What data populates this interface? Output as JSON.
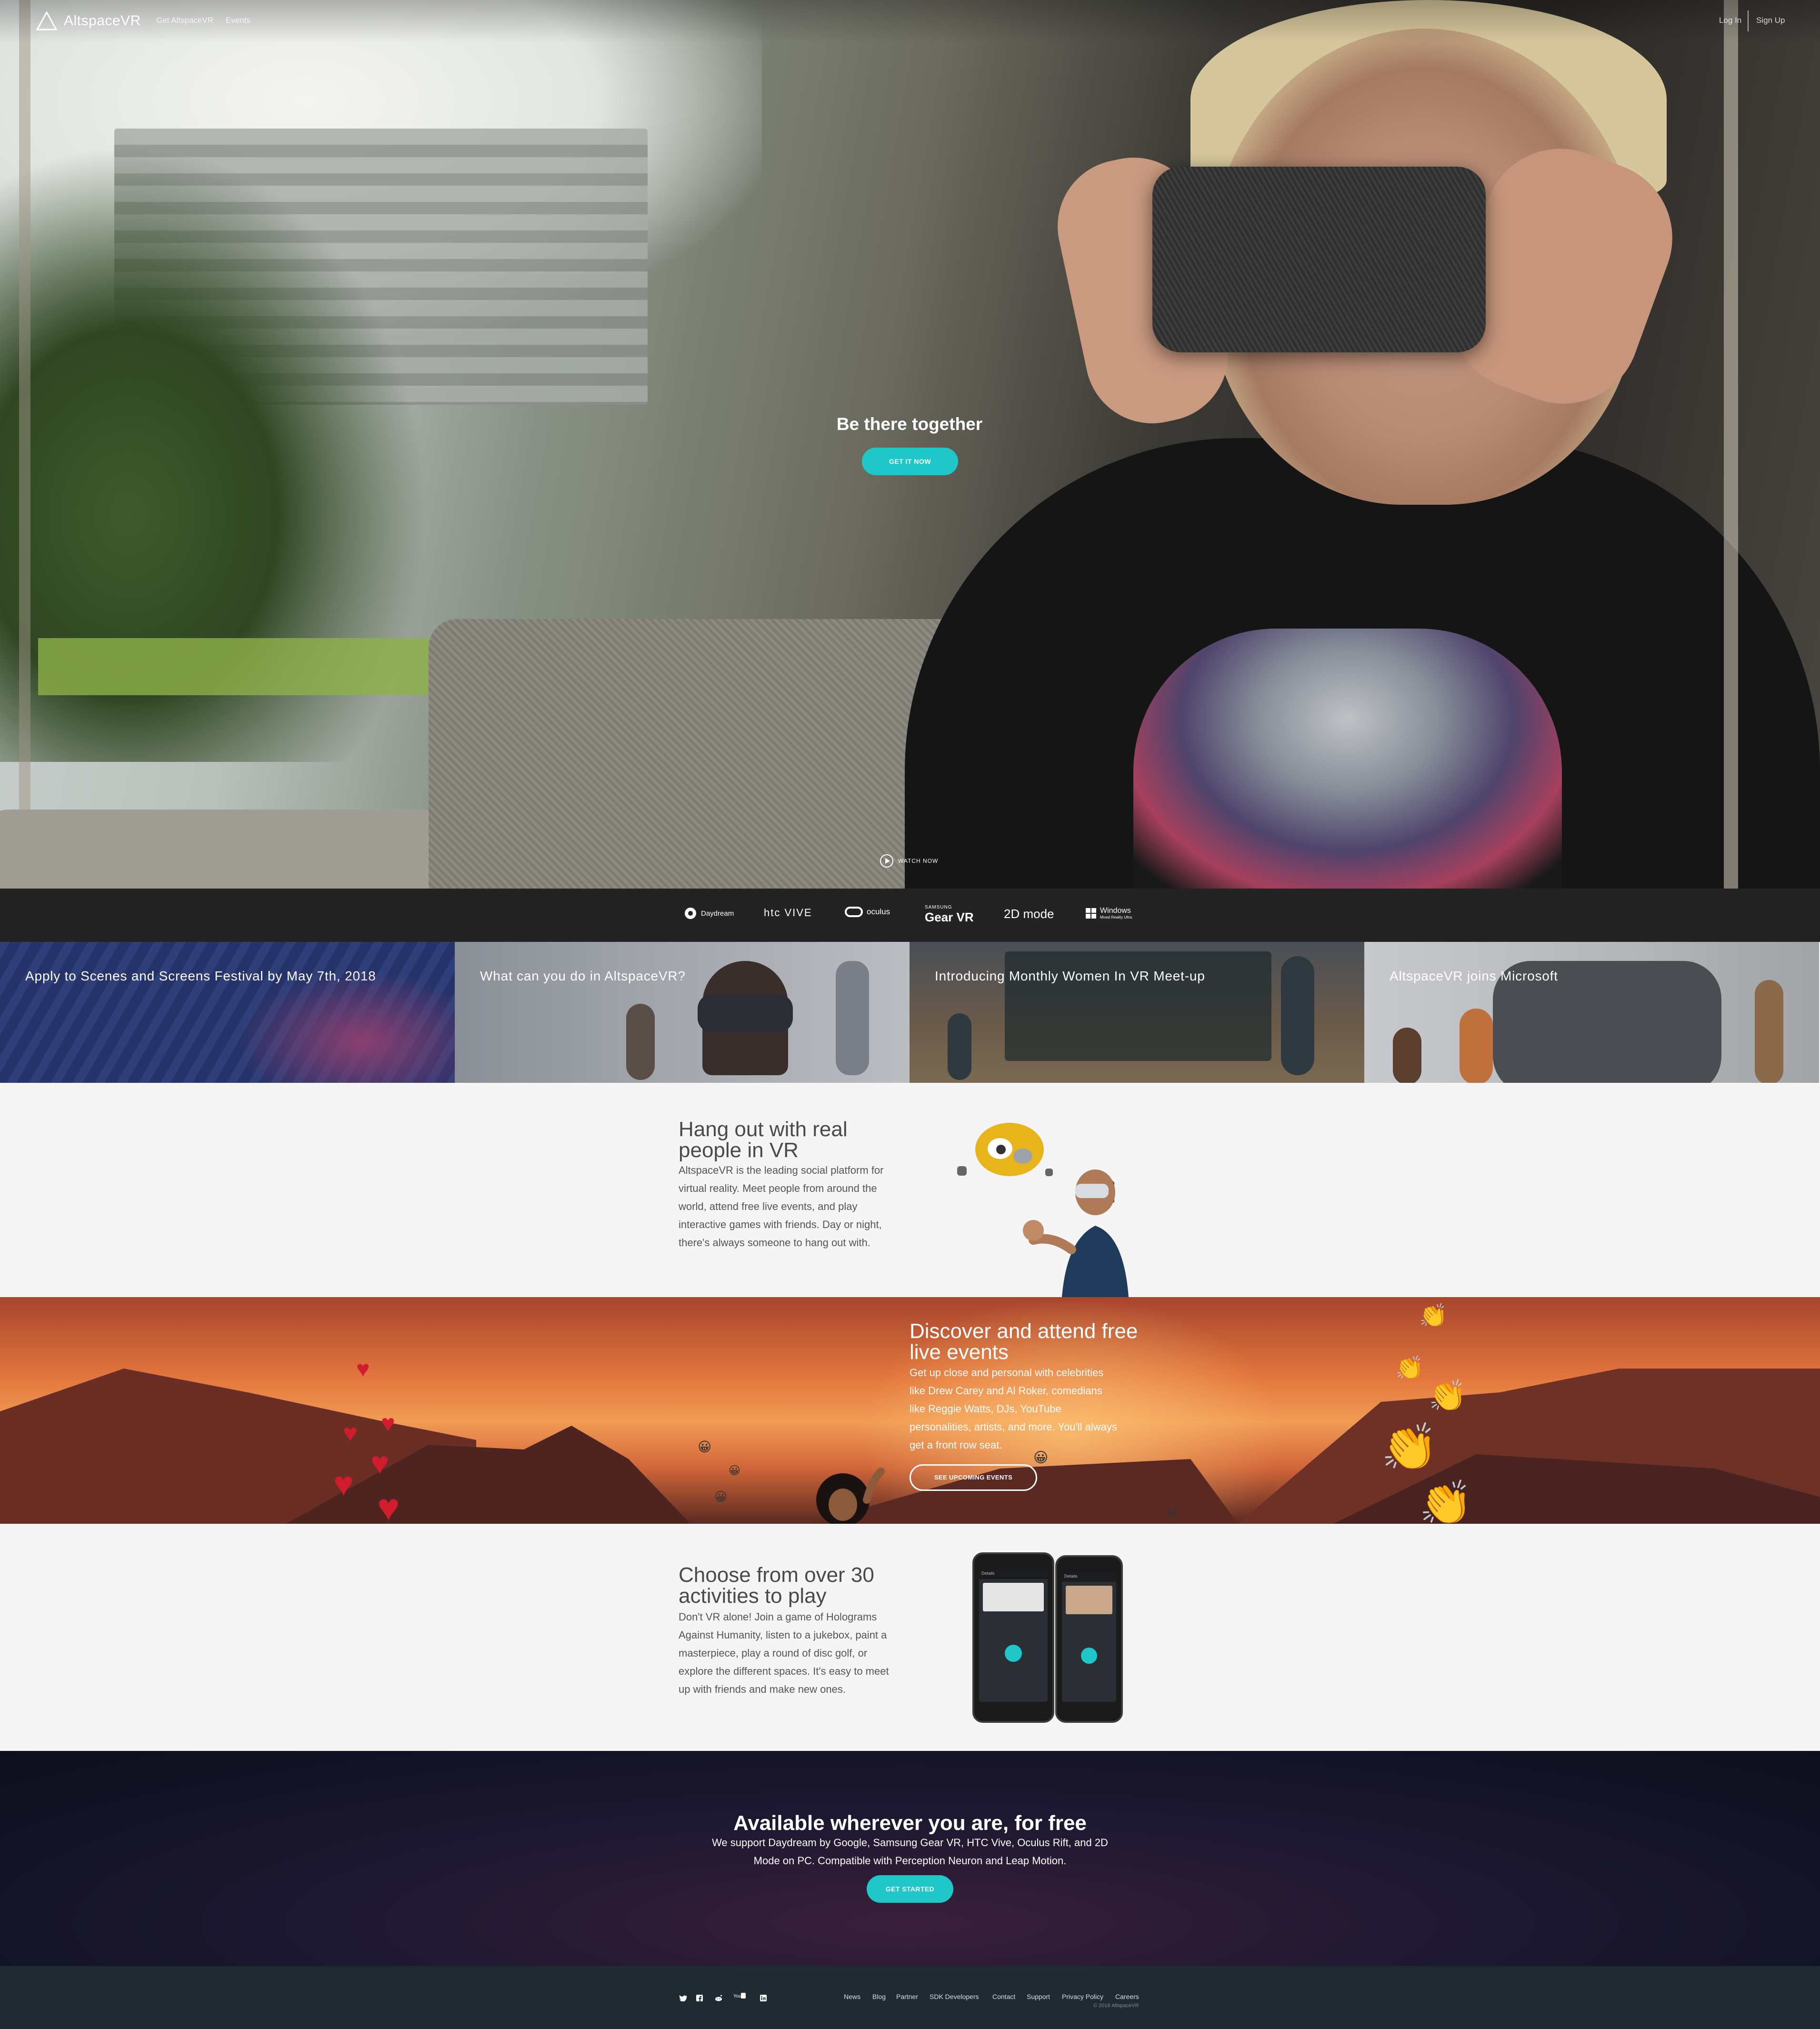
{
  "nav": {
    "brand": "AltspaceVR",
    "links": [
      "Get AltspaceVR",
      "Events"
    ],
    "login": "Log In",
    "signup": "Sign Up"
  },
  "hero": {
    "title": "Be there together",
    "cta": "GET IT NOW",
    "watch": "WATCH NOW"
  },
  "platforms": [
    {
      "label": "Daydream",
      "icon": "daydream-icon"
    },
    {
      "label": "htc VIVE",
      "icon": "htc-vive-logo"
    },
    {
      "label": "oculus",
      "icon": "oculus-icon"
    },
    {
      "label": "Gear VR",
      "sublabel": "SAMSUNG",
      "icon": "gear-vr-logo"
    },
    {
      "label": "2D mode",
      "icon": "2d-mode-label"
    },
    {
      "label": "Windows",
      "sublabel": "Mixed Reality Ultra",
      "icon": "windows-icon"
    }
  ],
  "tiles": [
    {
      "title": "Apply to Scenes and Screens Festival by May 7th, 2018"
    },
    {
      "title": "What can you do in AltspaceVR?"
    },
    {
      "title": "Introducing Monthly Women In VR Meet-up"
    },
    {
      "title": "AltspaceVR joins Microsoft"
    }
  ],
  "hangout": {
    "title_line1": "Hang out with real",
    "title_line2": "people in VR",
    "lines": [
      "AltspaceVR is the leading social platform for",
      "virtual reality. Meet people from around the",
      "world, attend free live events, and play",
      "interactive games with friends. Day or night,",
      "there's always someone to hang out with."
    ]
  },
  "events": {
    "title_line1": "Discover and attend free",
    "title_line2": "live events",
    "lines": [
      "Get up close and personal with celebrities",
      "like Drew Carey and Al Roker, comedians",
      "like Reggie Watts, DJs, YouTube",
      "personalities, artists, and more. You'll always",
      "get a front row seat."
    ],
    "cta": "SEE UPCOMING EVENTS"
  },
  "activities": {
    "title_line1": "Choose from over 30",
    "title_line2": "activities to play",
    "lines": [
      "Don't VR alone! Join a game of Holograms",
      "Against Humanity, listen to a jukebox, paint a",
      "masterpiece, play a round of disc golf, or",
      "explore the different spaces. It's easy to meet",
      "up with friends and make new ones."
    ],
    "phone_labels": [
      "Details",
      "Details"
    ]
  },
  "available": {
    "title": "Available wherever you are, for free",
    "lines": [
      "We support Daydream by Google, Samsung Gear VR, HTC Vive, Oculus Rift, and 2D",
      "Mode on PC. Compatible with Perception Neuron and Leap Motion."
    ],
    "cta": "GET STARTED"
  },
  "footer": {
    "social": [
      "twitter-icon",
      "facebook-icon",
      "reddit-icon",
      "youtube-icon",
      "linkedin-icon"
    ],
    "links": [
      "News",
      "Blog",
      "Partner",
      "SDK Developers",
      "Contact",
      "Support",
      "Privacy Policy",
      "Careers"
    ],
    "copyright": "© 2018 AltspaceVR"
  },
  "colors": {
    "accent": "#1fc7c8",
    "footer": "#1f2a33",
    "platform_bar": "#232323"
  }
}
